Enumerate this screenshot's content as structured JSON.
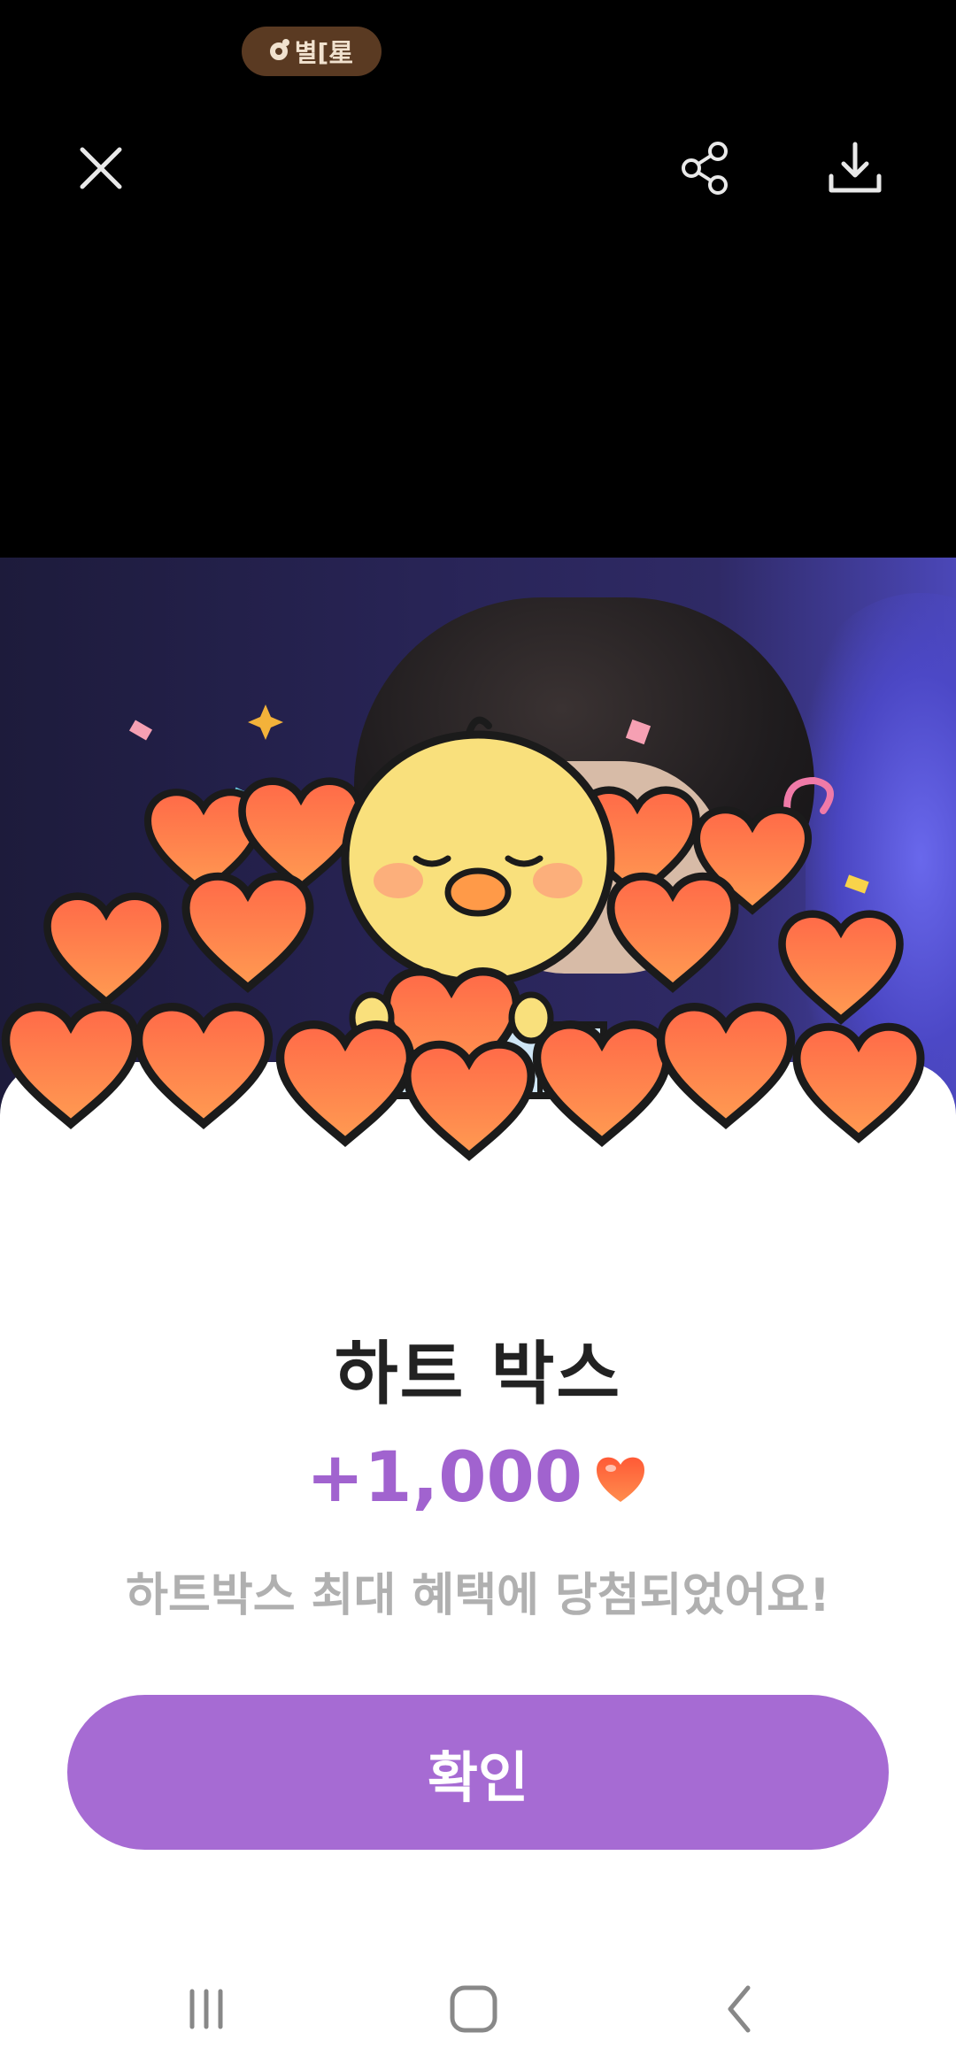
{
  "status_bar": {
    "pill_text": "별[星"
  },
  "top_bar": {
    "close_icon": "close-icon",
    "share_icon": "share-icon",
    "download_icon": "download-icon"
  },
  "reward": {
    "title": "하트 박스",
    "amount": "+1,000",
    "heart_icon": "heart-icon",
    "message": "하트박스 최대 혜택에 당첨되었어요!",
    "confirm_label": "확인"
  },
  "colors": {
    "accent": "#a66bd3",
    "amount": "#a163cf",
    "heart": "#ff5a36"
  },
  "nav": {
    "recent_icon": "recent-apps-icon",
    "home_icon": "home-icon",
    "back_icon": "back-icon"
  }
}
